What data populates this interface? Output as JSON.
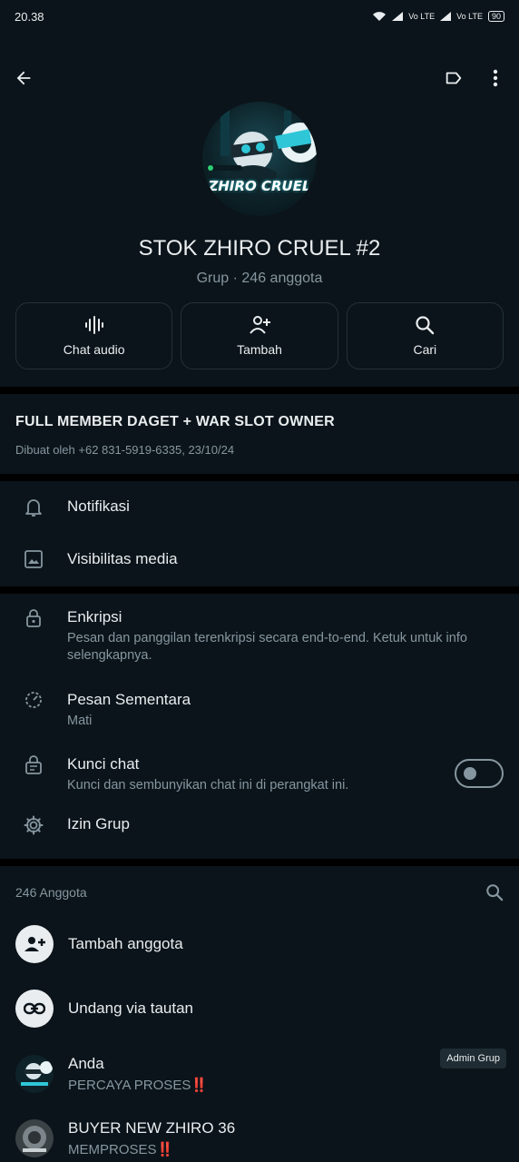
{
  "status": {
    "time": "20.38",
    "net1": "Vo LTE",
    "net2": "Vo LTE",
    "battery": "90"
  },
  "group": {
    "logo_text": "ZHIRO CRUEL",
    "name": "STOK ZHIRO CRUEL #2",
    "subtitle": "Grup · 246 anggota"
  },
  "actions": [
    {
      "label": "Chat audio",
      "icon": "audio-wave-icon"
    },
    {
      "label": "Tambah",
      "icon": "add-person-icon"
    },
    {
      "label": "Cari",
      "icon": "search-icon"
    }
  ],
  "description": {
    "title": "FULL MEMBER DAGET + WAR SLOT OWNER",
    "meta": "Dibuat oleh +62 831-5919-6335, 23/10/24"
  },
  "settings_a": [
    {
      "title": "Notifikasi",
      "icon": "bell-icon"
    },
    {
      "title": "Visibilitas media",
      "icon": "image-icon"
    }
  ],
  "settings_b": {
    "encryption": {
      "title": "Enkripsi",
      "sub": "Pesan dan panggilan terenkripsi secara end-to-end. Ketuk untuk info selengkapnya."
    },
    "disappearing": {
      "title": "Pesan Sementara",
      "sub": "Mati"
    },
    "lock": {
      "title": "Kunci chat",
      "sub": "Kunci dan sembunyikan chat ini di perangkat ini.",
      "toggle_on": false
    },
    "permissions": {
      "title": "Izin Grup"
    }
  },
  "members": {
    "count_label": "246 Anggota",
    "add_label": "Tambah anggota",
    "invite_label": "Undang via tautan",
    "list": [
      {
        "name": "Anda",
        "status": "PERCAYA PROSES",
        "badge": "Admin Grup"
      },
      {
        "name": "BUYER NEW ZHIRO 36",
        "status": "MEMPROSES",
        "badge": ""
      }
    ],
    "exclaim": "‼️"
  },
  "colors": {
    "background": "#0b141a",
    "secondary_text": "#8696a0",
    "divider": "#000000"
  }
}
